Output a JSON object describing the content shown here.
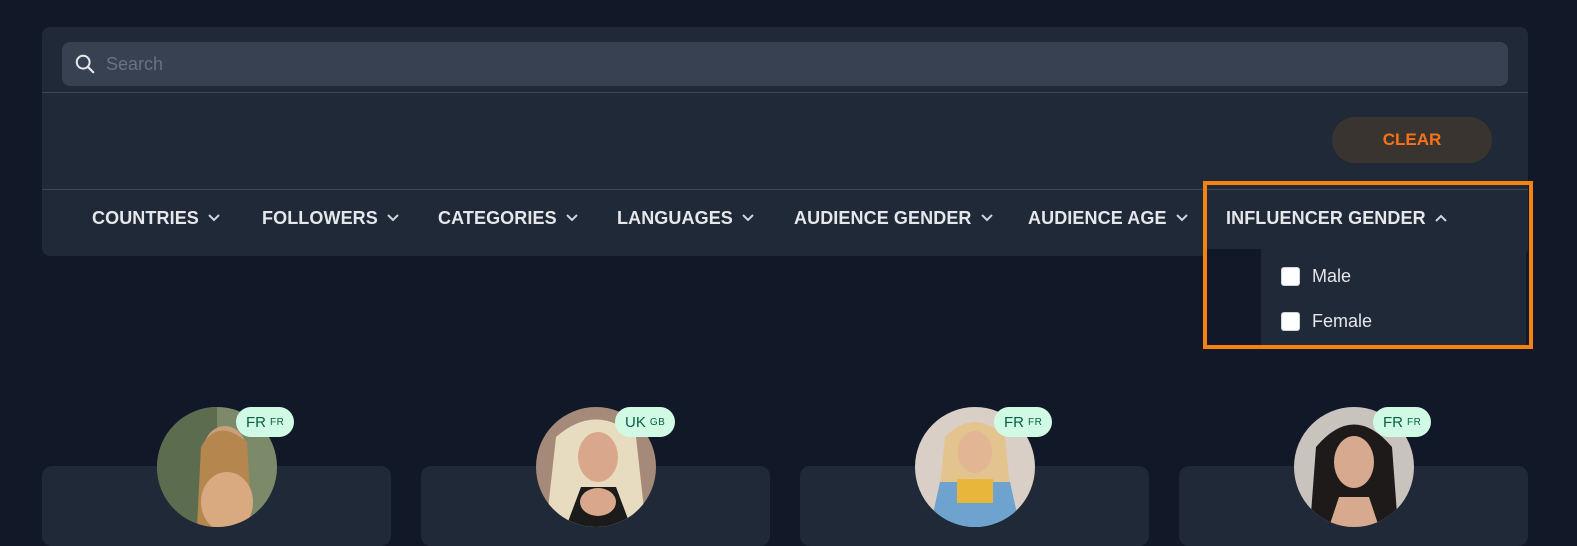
{
  "search": {
    "placeholder": "Search"
  },
  "clear_label": "CLEAR",
  "filters": [
    {
      "label": "COUNTRIES",
      "expanded": false
    },
    {
      "label": "FOLLOWERS",
      "expanded": false
    },
    {
      "label": "CATEGORIES",
      "expanded": false
    },
    {
      "label": "LANGUAGES",
      "expanded": false
    },
    {
      "label": "AUDIENCE GENDER",
      "expanded": false
    },
    {
      "label": "AUDIENCE AGE",
      "expanded": false
    },
    {
      "label": "INFLUENCER GENDER",
      "expanded": true
    }
  ],
  "influencer_gender_options": [
    {
      "label": "Male",
      "checked": false
    },
    {
      "label": "Female",
      "checked": false
    }
  ],
  "influencers": [
    {
      "country": "FR",
      "flag": "FR"
    },
    {
      "country": "UK",
      "flag": "GB"
    },
    {
      "country": "FR",
      "flag": "FR"
    },
    {
      "country": "FR",
      "flag": "FR"
    }
  ],
  "colors": {
    "background": "#111827",
    "panel": "#1f2937",
    "accent": "#f97316",
    "highlight": "#f7820f",
    "badge": "#d1fae5"
  }
}
